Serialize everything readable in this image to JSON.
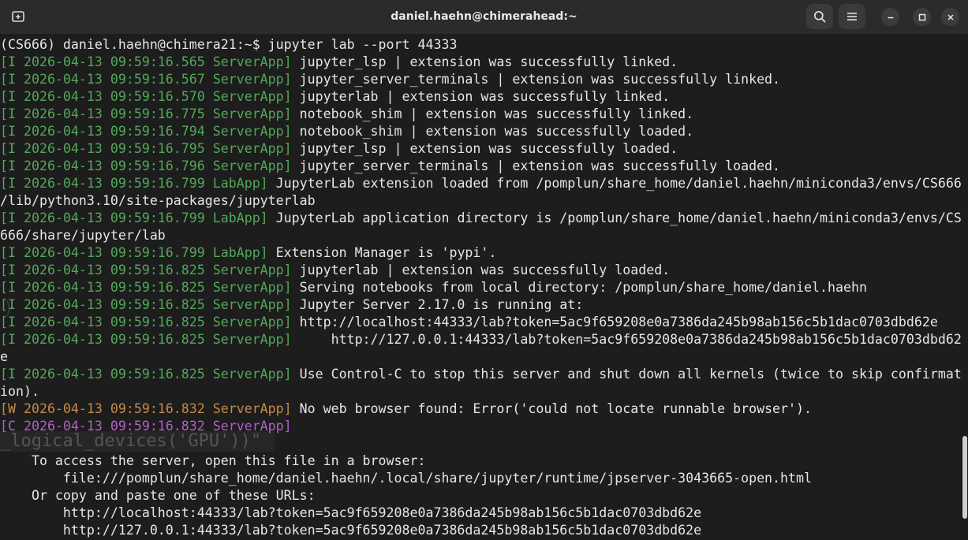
{
  "window": {
    "title": "daniel.haehn@chimerahead:~"
  },
  "titlebar": {
    "new_tab_icon": "new-tab-icon",
    "search_icon": "search-icon",
    "menu_icon": "hamburger-menu-icon",
    "minimize_icon": "minimize-icon",
    "maximize_icon": "maximize-icon",
    "close_icon": "close-icon"
  },
  "colors": {
    "info_prefix": "#52a858",
    "warning_prefix": "#c58a4a",
    "critical_prefix": "#b55ec7",
    "text": "#e6e6e6",
    "background": "#1d1d1d"
  },
  "terminal": {
    "lines": [
      {
        "prefix": "",
        "kind": "",
        "text": "(CS666) daniel.haehn@chimera21:~$ jupyter lab --port 44333"
      },
      {
        "prefix": "[I 2026-04-13 09:59:16.565 ServerApp]",
        "kind": "i",
        "text": " jupyter_lsp | extension was successfully linked."
      },
      {
        "prefix": "[I 2026-04-13 09:59:16.567 ServerApp]",
        "kind": "i",
        "text": " jupyter_server_terminals | extension was successfully linked."
      },
      {
        "prefix": "[I 2026-04-13 09:59:16.570 ServerApp]",
        "kind": "i",
        "text": " jupyterlab | extension was successfully linked."
      },
      {
        "prefix": "[I 2026-04-13 09:59:16.775 ServerApp]",
        "kind": "i",
        "text": " notebook_shim | extension was successfully linked."
      },
      {
        "prefix": "[I 2026-04-13 09:59:16.794 ServerApp]",
        "kind": "i",
        "text": " notebook_shim | extension was successfully loaded."
      },
      {
        "prefix": "[I 2026-04-13 09:59:16.795 ServerApp]",
        "kind": "i",
        "text": " jupyter_lsp | extension was successfully loaded."
      },
      {
        "prefix": "[I 2026-04-13 09:59:16.796 ServerApp]",
        "kind": "i",
        "text": " jupyter_server_terminals | extension was successfully loaded."
      },
      {
        "prefix": "[I 2026-04-13 09:59:16.799 LabApp]",
        "kind": "i",
        "text": " JupyterLab extension loaded from /pomplun/share_home/daniel.haehn/miniconda3/envs/CS666"
      },
      {
        "prefix": "",
        "kind": "",
        "text": "/lib/python3.10/site-packages/jupyterlab"
      },
      {
        "prefix": "[I 2026-04-13 09:59:16.799 LabApp]",
        "kind": "i",
        "text": " JupyterLab application directory is /pomplun/share_home/daniel.haehn/miniconda3/envs/CS"
      },
      {
        "prefix": "",
        "kind": "",
        "text": "666/share/jupyter/lab"
      },
      {
        "prefix": "[I 2026-04-13 09:59:16.799 LabApp]",
        "kind": "i",
        "text": " Extension Manager is 'pypi'."
      },
      {
        "prefix": "[I 2026-04-13 09:59:16.825 ServerApp]",
        "kind": "i",
        "text": " jupyterlab | extension was successfully loaded."
      },
      {
        "prefix": "[I 2026-04-13 09:59:16.825 ServerApp]",
        "kind": "i",
        "text": " Serving notebooks from local directory: /pomplun/share_home/daniel.haehn"
      },
      {
        "prefix": "[I 2026-04-13 09:59:16.825 ServerApp]",
        "kind": "i",
        "text": " Jupyter Server 2.17.0 is running at:"
      },
      {
        "prefix": "[I 2026-04-13 09:59:16.825 ServerApp]",
        "kind": "i",
        "text": " http://localhost:44333/lab?token=5ac9f659208e0a7386da245b98ab156c5b1dac0703dbd62e"
      },
      {
        "prefix": "[I 2026-04-13 09:59:16.825 ServerApp]",
        "kind": "i",
        "text": "     http://127.0.0.1:44333/lab?token=5ac9f659208e0a7386da245b98ab156c5b1dac0703dbd62"
      },
      {
        "prefix": "",
        "kind": "",
        "text": "e"
      },
      {
        "prefix": "[I 2026-04-13 09:59:16.825 ServerApp]",
        "kind": "i",
        "text": " Use Control-C to stop this server and shut down all kernels (twice to skip confirmat"
      },
      {
        "prefix": "",
        "kind": "",
        "text": "ion)."
      },
      {
        "prefix": "[W 2026-04-13 09:59:16.832 ServerApp]",
        "kind": "w",
        "text": " No web browser found: Error('could not locate runnable browser')."
      },
      {
        "prefix": "[C 2026-04-13 09:59:16.832 ServerApp]",
        "kind": "c",
        "text": ""
      },
      {
        "prefix": "",
        "kind": "",
        "text": "    "
      },
      {
        "prefix": "",
        "kind": "",
        "text": "    To access the server, open this file in a browser:"
      },
      {
        "prefix": "",
        "kind": "",
        "text": "        file:///pomplun/share_home/daniel.haehn/.local/share/jupyter/runtime/jpserver-3043665-open.html"
      },
      {
        "prefix": "",
        "kind": "",
        "text": "    Or copy and paste one of these URLs:"
      },
      {
        "prefix": "",
        "kind": "",
        "text": "        http://localhost:44333/lab?token=5ac9f659208e0a7386da245b98ab156c5b1dac0703dbd62e"
      },
      {
        "prefix": "",
        "kind": "",
        "text": "        http://127.0.0.1:44333/lab?token=5ac9f659208e0a7386da245b98ab156c5b1dac0703dbd62e"
      }
    ],
    "ghost_text": "_logical_devices('GPU'))\"",
    "ghost_text_2": ")"
  }
}
